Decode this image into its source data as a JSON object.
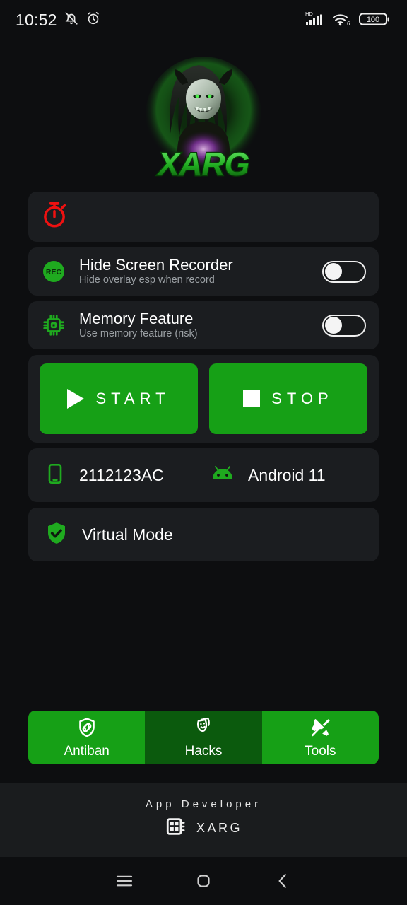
{
  "status_bar": {
    "time": "10:52",
    "icons_left": [
      "mute-icon",
      "alarm-icon"
    ],
    "network_label": "HD",
    "wifi_label": "6",
    "battery_level": "100"
  },
  "logo": {
    "brand_text": "XARG",
    "icon": "xarg-mascot-logo",
    "glow_color": "#2fd12f"
  },
  "timer_card": {
    "icon": "stopwatch-icon",
    "icon_color": "#ee1111"
  },
  "toggles": [
    {
      "icon": "rec-icon",
      "title": "Hide Screen Recorder",
      "subtitle": "Hide overlay esp when record",
      "state": "off"
    },
    {
      "icon": "memory-chip-icon",
      "title": "Memory Feature",
      "subtitle": "Use memory feature (risk)",
      "state": "off"
    }
  ],
  "actions": {
    "start_label": "START",
    "stop_label": "STOP",
    "start_icon": "play-icon",
    "stop_icon": "stop-square-icon",
    "button_color": "#16a016"
  },
  "device": {
    "phone_icon": "smartphone-icon",
    "model": "2112123AC",
    "android_icon": "android-robot-icon",
    "os": "Android 11"
  },
  "virtual": {
    "icon": "shield-check-icon",
    "label": "Virtual Mode"
  },
  "tabs": [
    {
      "label": "Antiban",
      "icon": "shield-link-icon",
      "selected": false
    },
    {
      "label": "Hacks",
      "icon": "masks-icon",
      "selected": true
    },
    {
      "label": "Tools",
      "icon": "tools-icon",
      "selected": false
    }
  ],
  "footer": {
    "title": "App Developer",
    "icon": "chip-card-icon",
    "name": "XARG"
  },
  "navbar": {
    "recents_icon": "menu-icon",
    "home_icon": "home-square-icon",
    "back_icon": "back-chevron-icon"
  }
}
